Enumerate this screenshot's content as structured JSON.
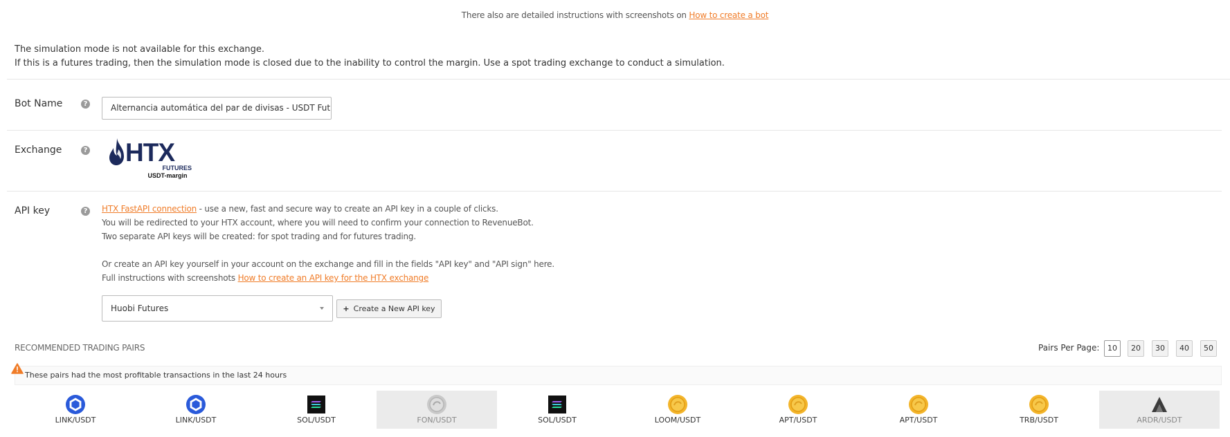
{
  "top_note": {
    "text": "There also are detailed instructions with screenshots on ",
    "link": "How to create a bot"
  },
  "simulation_notice": {
    "line1": "The simulation mode is not available for this exchange.",
    "line2": "If this is a futures trading, then the simulation mode is closed due to the inability to control the margin. Use a spot trading exchange to conduct a simulation."
  },
  "bot_name": {
    "label": "Bot Name",
    "value": "Alternancia automática del par de divisas - USDT Futures"
  },
  "exchange": {
    "label": "Exchange",
    "logo_text": "HTX",
    "logo_sub1": "FUTURES",
    "logo_sub2": "USDT-margin",
    "logo_color": "#1c2a5c",
    "logo_flame_color": "#1c2a5c"
  },
  "api_key": {
    "label": "API key",
    "fastapi_link": "HTX FastAPI connection",
    "line1_rest": " - use a new, fast and secure way to create an API key in a couple of clicks.",
    "line2": "You will be redirected to your HTX account, where you will need to confirm your connection to RevenueBot.",
    "line3": "Two separate API keys will be created: for spot trading and for futures trading.",
    "line4": "Or create an API key yourself in your account on the exchange and fill in the fields \"API key\" and \"API sign\" here.",
    "line5_prefix": "Full instructions with screenshots ",
    "line5_link": "How to create an API key for the HTX exchange",
    "select_value": "Huobi Futures",
    "create_button": "Create a New API key"
  },
  "recommended": {
    "title": "RECOMMENDED TRADING PAIRS",
    "per_page_label": "Pairs Per Page:",
    "per_page_options": [
      "10",
      "20",
      "30",
      "40",
      "50"
    ],
    "per_page_selected": "10",
    "alert": "These pairs had the most profitable transactions in the last 24 hours",
    "pairs": [
      {
        "label": "LINK/USDT",
        "icon": "chainlink-icon"
      },
      {
        "label": "LINK/USDT",
        "icon": "chainlink-icon"
      },
      {
        "label": "SOL/USDT",
        "icon": "solana-icon"
      },
      {
        "label": "FON/USDT",
        "icon": "coin-icon"
      },
      {
        "label": "SOL/USDT",
        "icon": "solana-icon"
      },
      {
        "label": "LOOM/USDT",
        "icon": "coin-icon"
      },
      {
        "label": "APT/USDT",
        "icon": "coin-icon"
      },
      {
        "label": "APT/USDT",
        "icon": "coin-icon"
      },
      {
        "label": "TRB/USDT",
        "icon": "coin-icon"
      },
      {
        "label": "ARDR/USDT",
        "icon": "ardor-icon"
      }
    ]
  },
  "colors": {
    "accent_link": "#f07c28",
    "chainlink_blue": "#2a5ada",
    "coin_gold": "#f3b52b",
    "warning_orange": "#f07c28"
  }
}
